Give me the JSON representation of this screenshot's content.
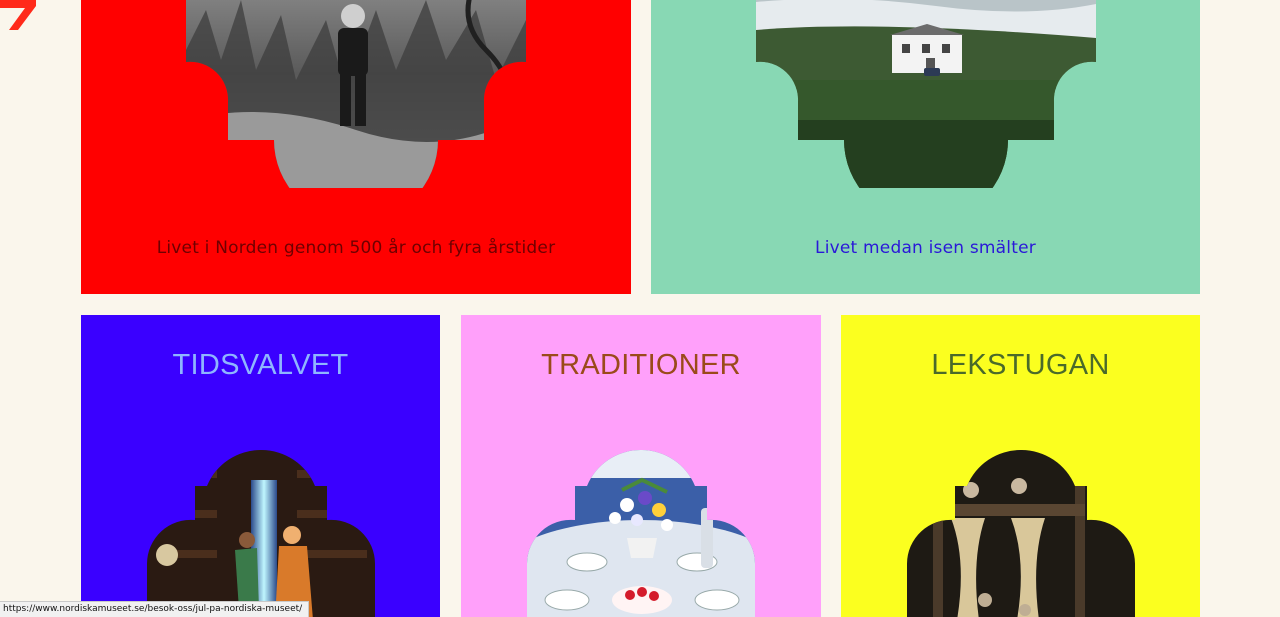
{
  "colors": {
    "page_bg": "#faf6ec",
    "card_red": "#ff0000",
    "card_mint": "#88d8b4",
    "card_blue": "#3a00ff",
    "card_pink": "#ffa0fa",
    "card_yellow": "#fbff1f",
    "logo_red": "#ff2a1a"
  },
  "cards": [
    {
      "caption": "Livet i Norden genom 500 år och fyra årstider",
      "text_color": "#6e0000",
      "image": "black-and-white photo of a child in a forest"
    },
    {
      "caption": "Livet medan isen smälter",
      "text_color": "#2a18d8",
      "image": "white house in front of a glacier"
    },
    {
      "heading": "TIDSVALVET",
      "text_color": "#8fb6ff",
      "image": "children opening a glowing door in a library"
    },
    {
      "heading": "TRADITIONER",
      "text_color": "#9a4a1a",
      "image": "festive table with flowers and desserts"
    },
    {
      "heading": "LEKSTUGAN",
      "text_color": "#4a6a2a",
      "image": "children in a wooden bunk bed"
    }
  ],
  "status_bar": {
    "url": "https://www.nordiskamuseet.se/besok-oss/jul-pa-nordiska-museet/"
  }
}
